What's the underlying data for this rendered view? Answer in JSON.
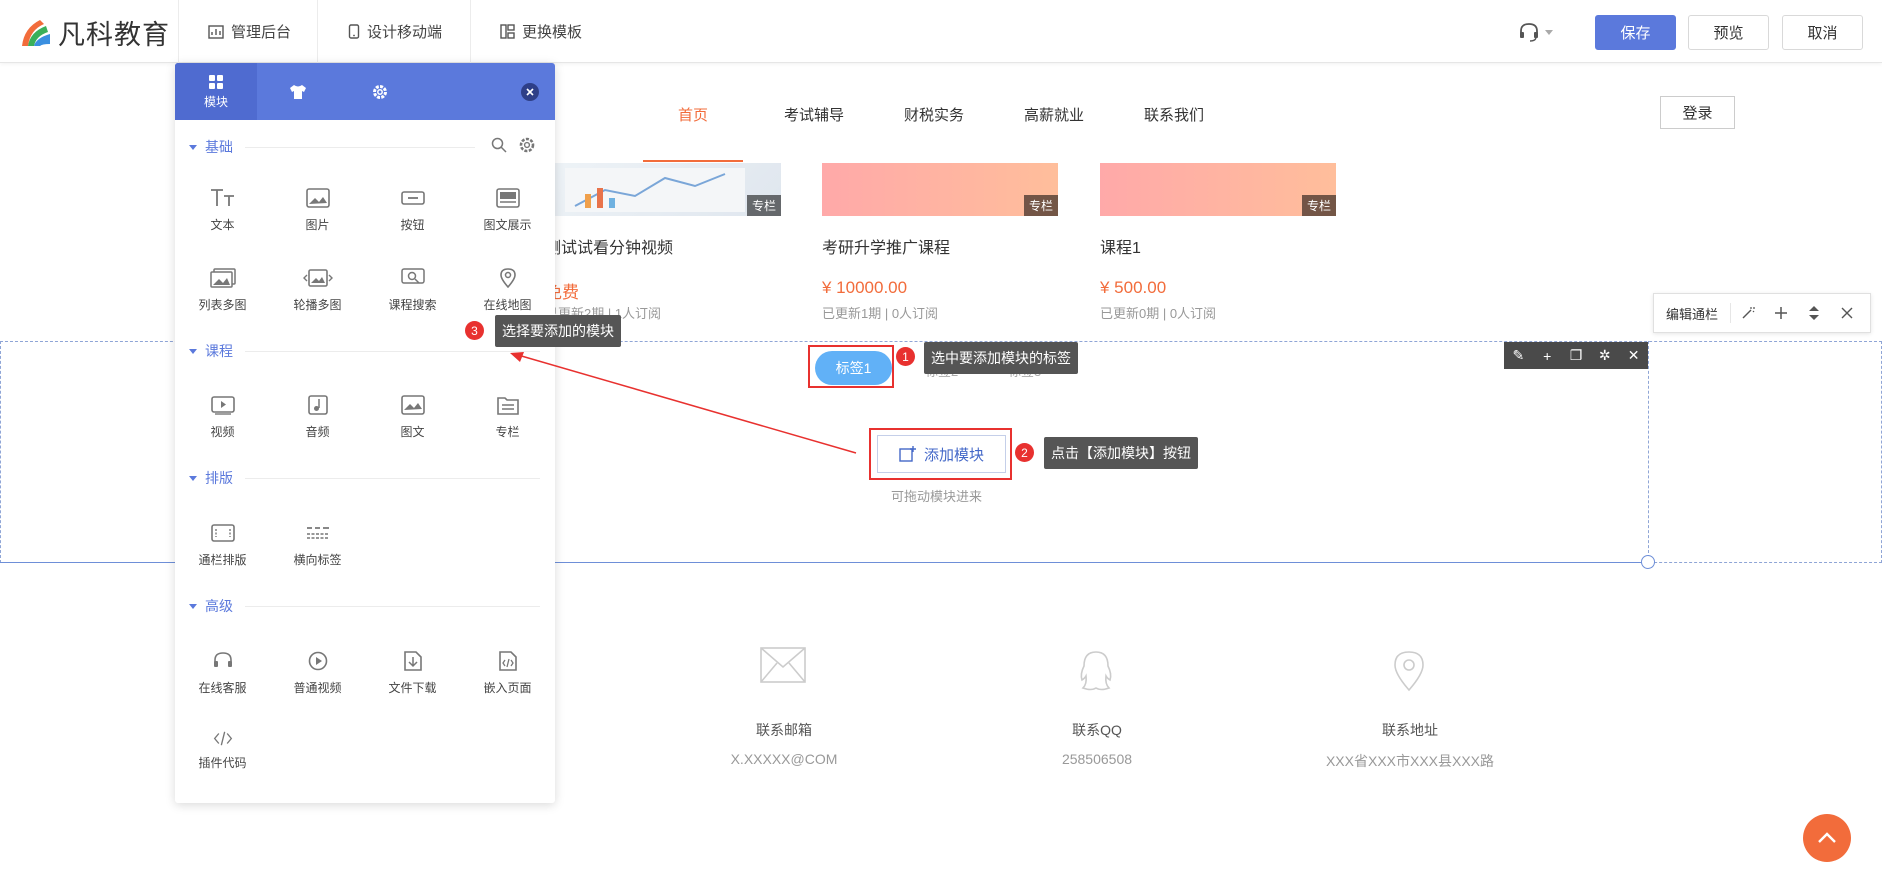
{
  "topbar": {
    "logo_text": "凡科教育",
    "tools": [
      {
        "label": "管理后台"
      },
      {
        "label": "设计移动端"
      },
      {
        "label": "更换模板"
      }
    ],
    "save_label": "保存",
    "preview_label": "预览",
    "cancel_label": "取消"
  },
  "site_nav": {
    "items": [
      "首页",
      "考试辅导",
      "财税实务",
      "高薪就业",
      "联系我们"
    ],
    "active_index": 0,
    "login_label": "登录"
  },
  "courses": [
    {
      "title": "测试试看分钟视频",
      "price": "免费",
      "meta": "已更新2期 | 1人订阅",
      "badge": "专栏"
    },
    {
      "title": "考研升学推广课程",
      "price": "¥ 10000.00",
      "meta": "已更新1期 | 0人订阅",
      "badge": "专栏"
    },
    {
      "title": "课程1",
      "price": "¥ 500.00",
      "meta": "已更新0期 | 0人订阅",
      "badge": "专栏"
    }
  ],
  "tabs_module": {
    "active_tab": "标签1",
    "other_tabs": [
      "标签2",
      "标签3"
    ],
    "add_module_label": "添加模块",
    "drag_hint": "可拖动模块进来"
  },
  "column_panel": {
    "label": "编辑通栏"
  },
  "steps": [
    {
      "num": "1",
      "text": "选中要添加模块的标签"
    },
    {
      "num": "2",
      "text": "点击【添加模块】按钮"
    },
    {
      "num": "3",
      "text": "选择要添加的模块"
    }
  ],
  "contact": [
    {
      "label": "联系邮箱",
      "value": "X.XXXXX@COM",
      "icon": "mail-icon"
    },
    {
      "label": "联系QQ",
      "value": "258506508",
      "icon": "qq-icon"
    },
    {
      "label": "联系地址",
      "value": "XXX省XXX市XXX县XXX路",
      "icon": "location-icon"
    }
  ],
  "module_panel": {
    "tabs": [
      {
        "label": "模块",
        "icon": "grid-icon"
      },
      {
        "label": "",
        "icon": "shirt-icon"
      },
      {
        "label": "",
        "icon": "gear-icon"
      }
    ],
    "sections": [
      {
        "title": "基础",
        "items": [
          "文本",
          "图片",
          "按钮",
          "图文展示",
          "列表多图",
          "轮播多图",
          "课程搜索",
          "在线地图"
        ]
      },
      {
        "title": "课程",
        "items": [
          "视频",
          "音频",
          "图文",
          "专栏"
        ]
      },
      {
        "title": "排版",
        "items": [
          "通栏排版",
          "横向标签"
        ]
      },
      {
        "title": "高级",
        "items": [
          "在线客服",
          "普通视频",
          "文件下载",
          "嵌入页面",
          "插件代码"
        ]
      }
    ]
  },
  "colors": {
    "primary": "#5b79dc",
    "accent": "#f26c3b",
    "highlight_red": "#e8312f",
    "tab_blue": "#61b1f7"
  }
}
